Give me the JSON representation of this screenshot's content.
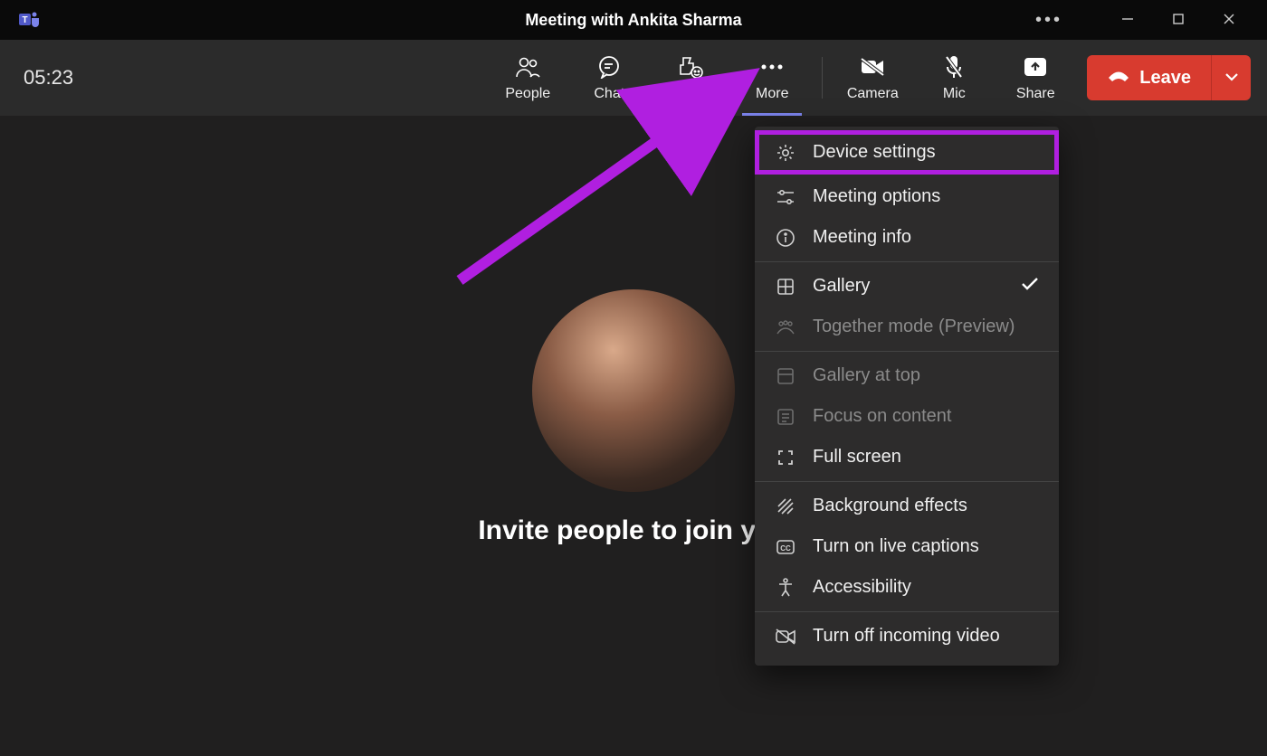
{
  "titlebar": {
    "title": "Meeting with Ankita Sharma"
  },
  "toolbar": {
    "timer": "05:23",
    "buttons": {
      "people": "People",
      "chat": "Chat",
      "react": "React",
      "more": "More",
      "camera": "Camera",
      "mic": "Mic",
      "share": "Share"
    },
    "leave_label": "Leave"
  },
  "main": {
    "invite_text": "Invite people to join you"
  },
  "menu": {
    "device_settings": "Device settings",
    "meeting_options": "Meeting options",
    "meeting_info": "Meeting info",
    "gallery": "Gallery",
    "together_mode": "Together mode (Preview)",
    "gallery_at_top": "Gallery at top",
    "focus_on_content": "Focus on content",
    "full_screen": "Full screen",
    "background_effects": "Background effects",
    "live_captions": "Turn on live captions",
    "accessibility": "Accessibility",
    "turn_off_incoming": "Turn off incoming video"
  },
  "annotation": {
    "highlight_color": "#b01fe0"
  }
}
